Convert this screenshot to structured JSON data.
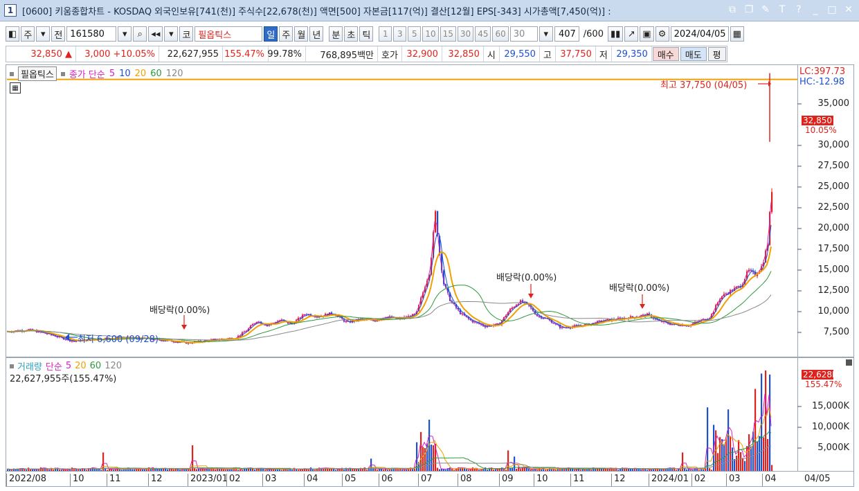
{
  "window": {
    "number": "1",
    "title": "[0600] 키움종합차트 - KOSDAQ 외국인보유[741(천)] 주식수[22,678(천)] 액면[500] 자본금[117(억)] 결산[12월] EPS[-343] 시가총액[7,450(억)] :"
  },
  "toolbar": {
    "market": "주",
    "all": "전",
    "code": "161580",
    "type_tag": "코",
    "stock_name": "필옵틱스",
    "periods": [
      "일",
      "주",
      "월",
      "년",
      "분",
      "초",
      "틱"
    ],
    "selected_period": "일",
    "intervals": [
      "1",
      "3",
      "5",
      "10",
      "15",
      "30",
      "45",
      "60"
    ],
    "interval_select": "30",
    "count": "407",
    "count_total": "/600",
    "date": "2024/04/05"
  },
  "quote": {
    "price": "32,850 ▲",
    "change": "3,000 +10.05%",
    "volume": "22,627,955",
    "vol_ratio": "155.47%",
    "ratio2": "99.78%",
    "amount": "768,895백만",
    "hoga_label": "호가",
    "ask": "32,900",
    "bid": "32,850",
    "open_label": "시",
    "open": "29,550",
    "high_label": "고",
    "high": "37,750",
    "low_label": "저",
    "low": "29,350",
    "buy": "매수",
    "sell": "매도",
    "flat": "평"
  },
  "price_panel": {
    "stock": "필옵틱스",
    "ma_label": "종가 단순",
    "ma_periods": [
      "5",
      "10",
      "20",
      "60",
      "120"
    ],
    "lc": "LC:397.73",
    "hc": "HC:-12.98",
    "current": "32,850",
    "current_pct": "10.05%",
    "y_labels": [
      "35,000",
      "32,500",
      "30,000",
      "27,500",
      "25,000",
      "22,500",
      "20,000",
      "17,500",
      "15,000",
      "12,500",
      "10,000",
      "7,500"
    ],
    "high_annot": "최고 37,750 (04/05)",
    "low_annot": "최저 6,600 (09/28)",
    "div1": "배당락(0.00%)",
    "div2": "배당락(0.00%)",
    "div3": "배당락(0.00%)"
  },
  "volume_panel": {
    "label": "거래량",
    "ma_label": "단순",
    "ma_periods": [
      "5",
      "20",
      "60",
      "120"
    ],
    "value": "22,627,955주(155.47%)",
    "current": "22,628K",
    "current_pct": "155.47%",
    "y_labels": [
      "15,000K",
      "10,000K",
      "5,000K"
    ]
  },
  "x_axis": [
    "2022/08",
    "10",
    "11",
    "12",
    "2023/01",
    "02",
    "03",
    "04",
    "05",
    "06",
    "07",
    "08",
    "09",
    "10",
    "11",
    "12",
    "2024/01",
    "02",
    "03",
    "04"
  ],
  "x_axis_last": "04/05",
  "colors": {
    "up": "#e0221c",
    "down": "#1d4fd1",
    "ma5": "#d81fbd",
    "ma10": "#1d4fd1",
    "ma20": "#f0a000",
    "ma60": "#2a9a3a",
    "ma120": "#888888"
  },
  "chart_data": {
    "type": "line",
    "x": [
      "2022/08",
      "2022/09",
      "2022/10",
      "2022/11",
      "2022/12",
      "2023/01",
      "2023/02",
      "2023/03",
      "2023/04",
      "2023/05",
      "2023/06",
      "2023/07",
      "2023/07",
      "2023/08",
      "2023/09",
      "2023/10",
      "2023/11",
      "2023/12",
      "2024/01",
      "2024/02",
      "2024/03",
      "2024/03",
      "2024/04"
    ],
    "series": [
      {
        "name": "종가",
        "values": [
          8600,
          7400,
          8300,
          7900,
          7700,
          7600,
          8200,
          9600,
          10300,
          9800,
          10100,
          21500,
          11500,
          9000,
          12000,
          9200,
          9500,
          10000,
          9300,
          10200,
          13000,
          17000,
          32850
        ]
      }
    ],
    "ylim": [
      6000,
      38500
    ],
    "volume_ylim": [
      0,
      24000
    ]
  }
}
